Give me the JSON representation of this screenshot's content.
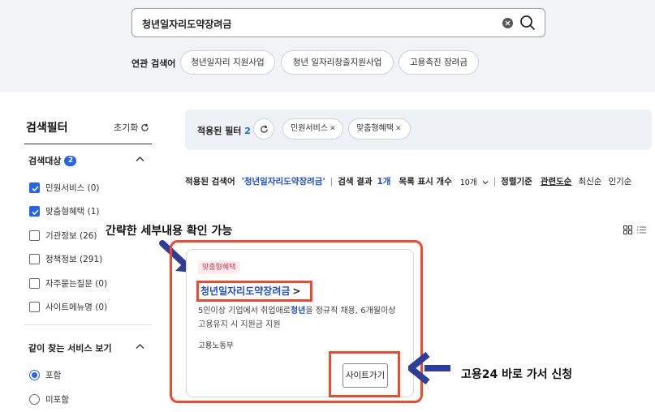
{
  "search": {
    "query": "청년일자리도약장려금"
  },
  "related": {
    "label": "연관 검색어",
    "chips": [
      "청년일자리 지원사업",
      "청년 일자리창출지원사업",
      "고용촉진 장려금"
    ]
  },
  "sidebar": {
    "title": "검색필터",
    "reset_label": "초기화",
    "target": {
      "title": "검색대상",
      "count": "2",
      "items": [
        {
          "label": "민원서비스 (0)",
          "checked": true
        },
        {
          "label": "맞춤형혜택 (1)",
          "checked": true
        },
        {
          "label": "기관정보 (26)",
          "checked": false
        },
        {
          "label": "정책정보 (291)",
          "checked": false
        },
        {
          "label": "자주묻는질문 (0)",
          "checked": false
        },
        {
          "label": "사이트메뉴명 (0)",
          "checked": false
        }
      ]
    },
    "together": {
      "title": "같이 찾는 서비스 보기",
      "options": [
        {
          "label": "포함",
          "selected": true
        },
        {
          "label": "미포함",
          "selected": false
        }
      ]
    }
  },
  "applied": {
    "label": "적용된 필터",
    "count": "2",
    "chips": [
      "민원서비스",
      "맞춤형혜택"
    ]
  },
  "results": {
    "query_label": "적용된 검색어",
    "query_value": "'청년일자리도약장려금'",
    "count_label": "검색 결과",
    "count_value": "1개",
    "page_size_label": "목록 표시 개수",
    "page_size_value": "10개",
    "sort_label": "정렬기준",
    "sort_options": [
      "관련도순",
      "최신순",
      "인기순"
    ]
  },
  "annotations": {
    "top": "간략한 세부내용 확인 가능",
    "right": "고용24 바로 가서 신청"
  },
  "card": {
    "tag": "맞춤형혜택",
    "title": "청년일자리도약장려금",
    "arrow": ">",
    "desc_before": "5인이상 기업에서 취업애로",
    "desc_highlight": "청년",
    "desc_after": "을 정규직 채용, 6개월이상 고용유지 시 지원금 지원",
    "org": "고용노동부",
    "button": "사이트가기"
  },
  "colors": {
    "accent": "#2563eb",
    "annotation": "#f04a2c",
    "arrow": "#2e3d9a"
  }
}
